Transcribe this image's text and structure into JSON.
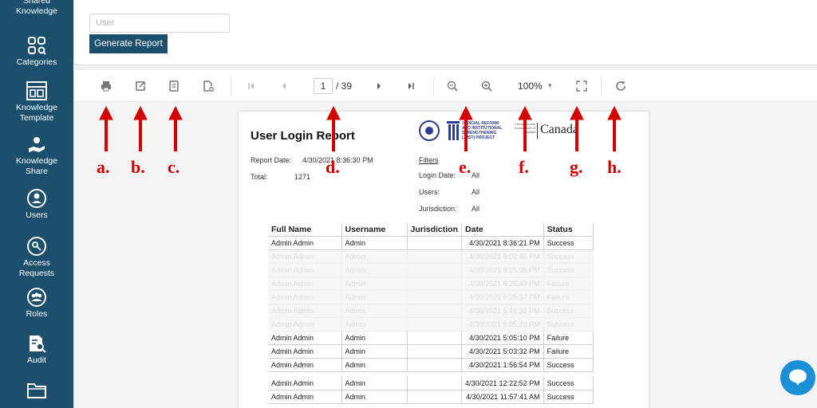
{
  "sidebar": {
    "items": [
      {
        "label": "Shared\nKnowledge",
        "icon": "knowledge-icon"
      },
      {
        "label": "Categories",
        "icon": "categories-icon"
      },
      {
        "label": "Knowledge\nTemplate",
        "icon": "template-icon"
      },
      {
        "label": "Knowledge\nShare",
        "icon": "share-hand-icon"
      },
      {
        "label": "Users",
        "icon": "user-circle-icon"
      },
      {
        "label": "Access\nRequests",
        "icon": "access-key-icon"
      },
      {
        "label": "Roles",
        "icon": "group-icon"
      },
      {
        "label": "Audit",
        "icon": "audit-search-icon"
      },
      {
        "label": "",
        "icon": "folder-icon"
      }
    ]
  },
  "filters": {
    "user_placeholder": "User",
    "generate_label": "Generate Report"
  },
  "toolbar": {
    "page_current": "1",
    "page_total": "/ 39",
    "zoom": "100%"
  },
  "report": {
    "title": "User Login Report",
    "report_date_label": "Report Date:",
    "report_date_value": "4/30/2021 8:36:30 PM",
    "total_label": "Total:",
    "total_value": "1271",
    "filters_heading": "Filters",
    "login_date_label": "Login Date:",
    "login_date_value": "All",
    "users_label": "Users:",
    "users_value": "All",
    "jurisdiction_label": "Jurisdiction:",
    "jurisdiction_value": "All",
    "logo_text": "JUDICIAL REFORM AND INSTITUTIONAL STRENGTHENING (JUST) PROJECT",
    "funded_text": "Funded by the Government of Canada",
    "canada_text": "Canada",
    "columns": [
      "Full Name",
      "Username",
      "Jurisdiction",
      "Date",
      "Status"
    ],
    "rows": [
      {
        "full_name": "Admin Admin",
        "username": "Admin",
        "jurisdiction": "",
        "date": "4/30/2021 8:36:21 PM",
        "status": "Success",
        "faded": false
      },
      {
        "full_name": "Admin Admin",
        "username": "Admin",
        "jurisdiction": "",
        "date": "4/30/2021 8:02:46 PM",
        "status": "Success",
        "faded": true
      },
      {
        "full_name": "Admin Admin",
        "username": "Admin",
        "jurisdiction": "",
        "date": "4/30/2021 6:26:05 PM",
        "status": "Success",
        "faded": true
      },
      {
        "full_name": "Admin Admin",
        "username": "Admin",
        "jurisdiction": "",
        "date": "4/30/2021 6:25:49 PM",
        "status": "Failure",
        "faded": true
      },
      {
        "full_name": "Admin Admin",
        "username": "Admin",
        "jurisdiction": "",
        "date": "4/30/2021 6:25:37 PM",
        "status": "Failure",
        "faded": true
      },
      {
        "full_name": "Admin Admin",
        "username": "Admin",
        "jurisdiction": "",
        "date": "4/30/2021 5:46:32 PM",
        "status": "Success",
        "faded": true
      },
      {
        "full_name": "Admin Admin",
        "username": "Admin",
        "jurisdiction": "",
        "date": "4/30/2021 5:05:20 PM",
        "status": "Success",
        "faded": true
      },
      {
        "full_name": "Admin Admin",
        "username": "Admin",
        "jurisdiction": "",
        "date": "4/30/2021 5:05:10 PM",
        "status": "Failure",
        "faded": false
      },
      {
        "full_name": "Admin Admin",
        "username": "Admin",
        "jurisdiction": "",
        "date": "4/30/2021 5:03:32 PM",
        "status": "Failure",
        "faded": false
      },
      {
        "full_name": "Admin Admin",
        "username": "Admin",
        "jurisdiction": "",
        "date": "4/30/2021 1:56:54 PM",
        "status": "Success",
        "faded": false
      },
      {
        "full_name": "Admin Admin",
        "username": "Admin",
        "jurisdiction": "",
        "date": "4/30/2021 12:22:52 PM",
        "status": "Success",
        "faded": false
      },
      {
        "full_name": "Admin Admin",
        "username": "Admin",
        "jurisdiction": "",
        "date": "4/30/2021 11:57:41 AM",
        "status": "Success",
        "faded": false
      }
    ]
  },
  "annotations": [
    "a.",
    "b.",
    "c.",
    "d.",
    "e.",
    "f.",
    "g.",
    "h."
  ],
  "colors": {
    "sidebar": "#1b4f6b",
    "annotation": "#d40000",
    "chat": "#1b8fd6"
  }
}
